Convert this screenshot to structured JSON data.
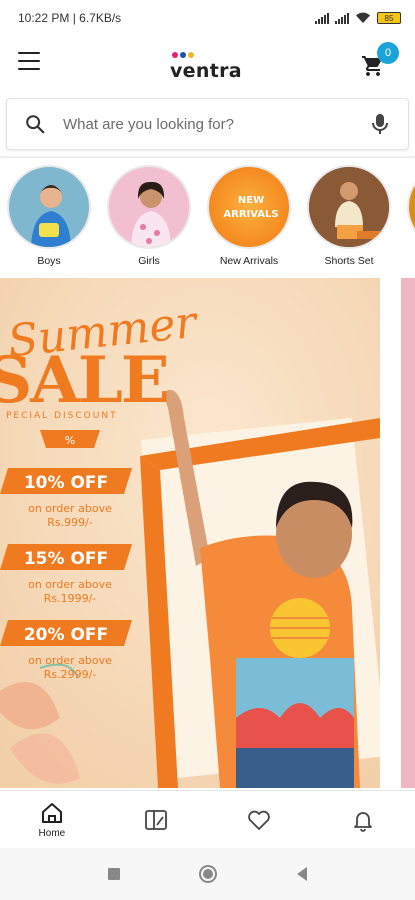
{
  "status_bar": {
    "time_speed": "10:22 PM | 6.7KB/s",
    "battery": "85"
  },
  "header": {
    "logo_text": "ventra",
    "cart_count": "0"
  },
  "search": {
    "placeholder": "What are you looking for?"
  },
  "categories": [
    {
      "label": "Boys"
    },
    {
      "label": "Girls"
    },
    {
      "label": "New Arrivals",
      "circle_text_1": "NEW",
      "circle_text_2": "ARRIVALS"
    },
    {
      "label": "Shorts Set"
    }
  ],
  "banner": {
    "script_title": "Summer",
    "big_title": "SALE",
    "subtitle": "PECIAL DISCOUNT",
    "percent_sign": "%",
    "offers": [
      {
        "tag": "10% OFF",
        "line1": "on order above",
        "line2": "Rs.999/-"
      },
      {
        "tag": "15% OFF",
        "line1": "on order above",
        "line2": "Rs.1999/-"
      },
      {
        "tag": "20% OFF",
        "line1": "on order above",
        "line2": "Rs.2999/-"
      }
    ]
  },
  "bottom_nav": {
    "home_label": "Home"
  },
  "colors": {
    "accent_orange": "#f07a1f",
    "cart_badge": "#1aa3d9",
    "banner_bg": "#f7d9b8"
  }
}
